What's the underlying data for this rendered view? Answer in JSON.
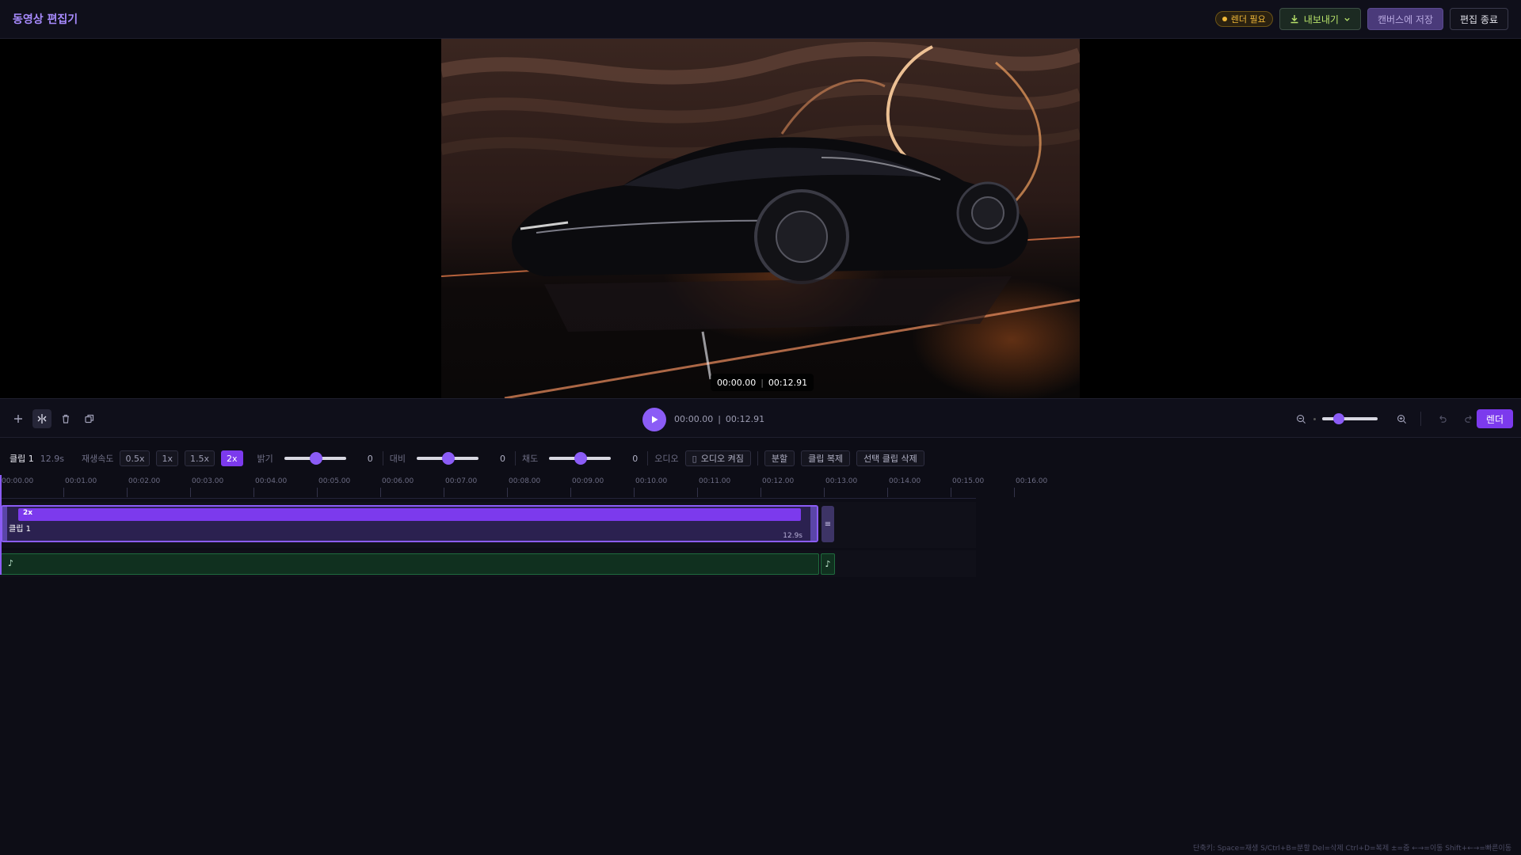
{
  "header": {
    "title": "동영상 편집기",
    "render_needed": "렌더 필요",
    "export_label": "내보내기",
    "save_label": "캔버스에 저장",
    "exit_label": "편집 종료"
  },
  "preview": {
    "current_time": "00:00.00",
    "total_time": "00:12.91"
  },
  "toolbar": {
    "current_time": "00:00.00",
    "total_time": "00:12.91",
    "render_label": "렌더",
    "zoom_level": 0.25
  },
  "properties": {
    "clip_name": "클립 1",
    "clip_duration": "12.9s",
    "speed_label": "재생속도",
    "speed_options": [
      "0.5x",
      "1x",
      "1.5x",
      "2x"
    ],
    "speed_selected": "2x",
    "brightness_label": "밝기",
    "brightness_value": "0",
    "contrast_label": "대비",
    "contrast_value": "0",
    "saturation_label": "채도",
    "saturation_value": "0",
    "audio_label": "오디오",
    "audio_toggle": "오디오 켜짐",
    "split_label": "분할",
    "duplicate_label": "클립 복제",
    "delete_label": "선택 클립 삭제"
  },
  "timeline": {
    "ticks": [
      "00:00.00",
      "00:01.00",
      "00:02.00",
      "00:03.00",
      "00:04.00",
      "00:05.00",
      "00:06.00",
      "00:07.00",
      "00:08.00",
      "00:09.00",
      "00:10.00",
      "00:11.00",
      "00:12.00",
      "00:13.00",
      "00:14.00",
      "00:15.00",
      "00:16.00"
    ],
    "video_clip": {
      "speed": "2x",
      "name": "클립 1",
      "duration": "12.9s"
    },
    "audio_icon": "♪"
  },
  "footer": {
    "shortcuts": "단축키: Space=재생 S/Ctrl+B=분할 Del=삭제 Ctrl+D=복제 ±=줌 ←→=이동 Shift+←→=빠른이동"
  },
  "colors": {
    "accent": "#8b5cf6",
    "render_badge": "#f1b838",
    "export_text": "#b8e36a",
    "audio_track": "#1f6b3e"
  }
}
